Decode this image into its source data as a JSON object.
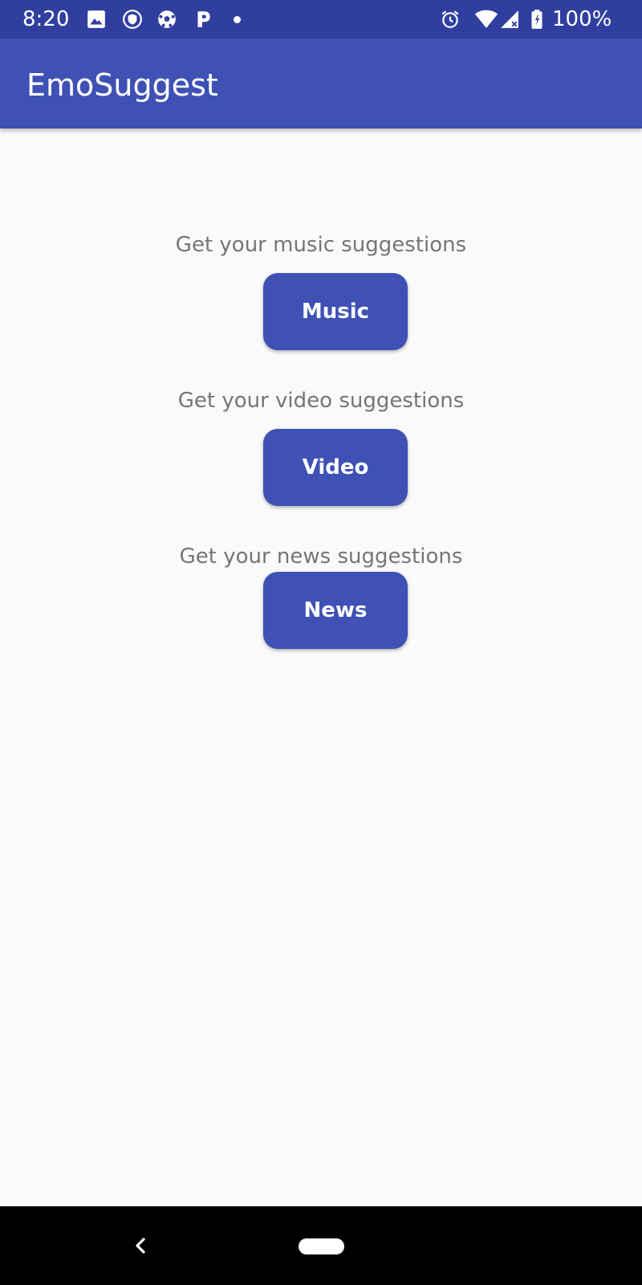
{
  "status_bar": {
    "time": "8:20",
    "battery_percent": "100%",
    "icons": [
      "image-icon",
      "shield-icon",
      "soccer-ball-icon",
      "p-icon",
      "dot-icon",
      "alarm-icon",
      "wifi-icon",
      "signal-icon",
      "battery-icon"
    ]
  },
  "app_bar": {
    "title": "EmoSuggest"
  },
  "sections": [
    {
      "prompt": "Get your music suggestions",
      "button_label": "Music"
    },
    {
      "prompt": "Get your video suggestions",
      "button_label": "Video"
    },
    {
      "prompt": "Get your news suggestions",
      "button_label": "News"
    }
  ],
  "colors": {
    "status_bar": "#303f9f",
    "primary": "#3f51b5",
    "background": "#fafafa",
    "prompt_text": "#757575"
  },
  "nav_bar": {
    "icons": [
      "back-icon",
      "home-pill-icon"
    ]
  }
}
